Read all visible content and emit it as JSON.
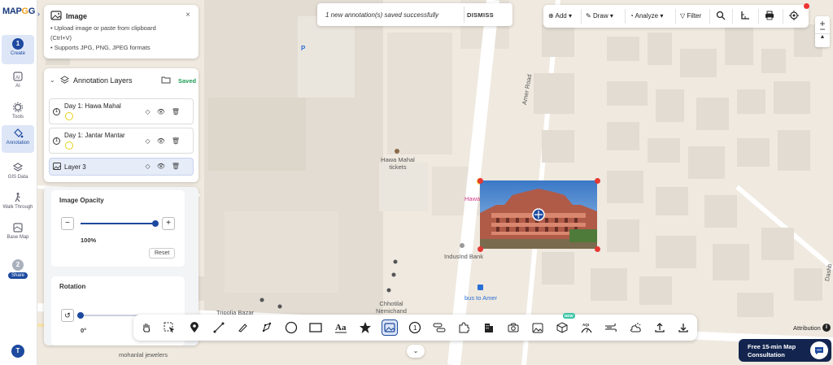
{
  "app": {
    "logo_main": "MAP",
    "logo_accent": "G",
    "logo_tail": "G"
  },
  "rail": {
    "items": [
      {
        "label": "Create",
        "step": "1"
      },
      {
        "label": "AI"
      },
      {
        "label": "Tools"
      },
      {
        "label": "Annotation"
      },
      {
        "label": "GIS Data"
      },
      {
        "label": "Walk Through"
      },
      {
        "label": "Base Map"
      },
      {
        "label": "Share",
        "step": "2"
      }
    ],
    "avatar": "T"
  },
  "image_panel": {
    "title": "Image",
    "line1": "• Upload image or paste from clipboard",
    "line2": "(Ctrl+V)",
    "line3": "• Supports JPG, PNG, JPEG formats",
    "close": "×"
  },
  "layers_panel": {
    "title": "Annotation Layers",
    "status": "Saved",
    "layers": [
      {
        "name": "Day 1: Hawa Mahal",
        "num": "1"
      },
      {
        "name": "Day 1: Jantar Mantar",
        "num": "1"
      },
      {
        "name": "Layer 3"
      }
    ]
  },
  "props": {
    "opacity_label": "Image Opacity",
    "opacity_value": "100%",
    "opacity_fraction": 1.0,
    "reset_label": "Reset",
    "rotation_label": "Rotation",
    "rotation_value": "0°",
    "minus": "−",
    "plus": "+"
  },
  "toast": {
    "message": "1 new annotation(s) saved successfully",
    "dismiss": "DISMISS"
  },
  "top_tools": {
    "add": "Add",
    "draw": "Draw",
    "analyze": "Analyze",
    "filter": "Filter"
  },
  "zoom": {
    "in": "+",
    "out": "−"
  },
  "map_labels": {
    "hawa_mahal_tickets_1": "Hawa Mahal",
    "hawa_mahal_tickets_2": "tickets",
    "hawa": "Hawa",
    "indusind": "IndusInd Bank",
    "bus": "bus to Amer",
    "amer_road": "Amer Road",
    "chhotilal_1": "Chhotilal",
    "chhotilal_2": "Nemichand",
    "tripolia": "Tripolia Bazar",
    "mohanlal": "mohanlal jewelers",
    "parking": "P",
    "dashb": "Dashb"
  },
  "attribution": "Attribution",
  "consult": {
    "line1": "Free 15-min Map",
    "line2": "Consultation"
  },
  "new_badge": "NEW",
  "colors": {
    "brand": "#1d4a9f",
    "saved": "#1f9d55",
    "handle": "#e53935",
    "map_bg": "#efe9df",
    "building": "#e3ddd3"
  }
}
